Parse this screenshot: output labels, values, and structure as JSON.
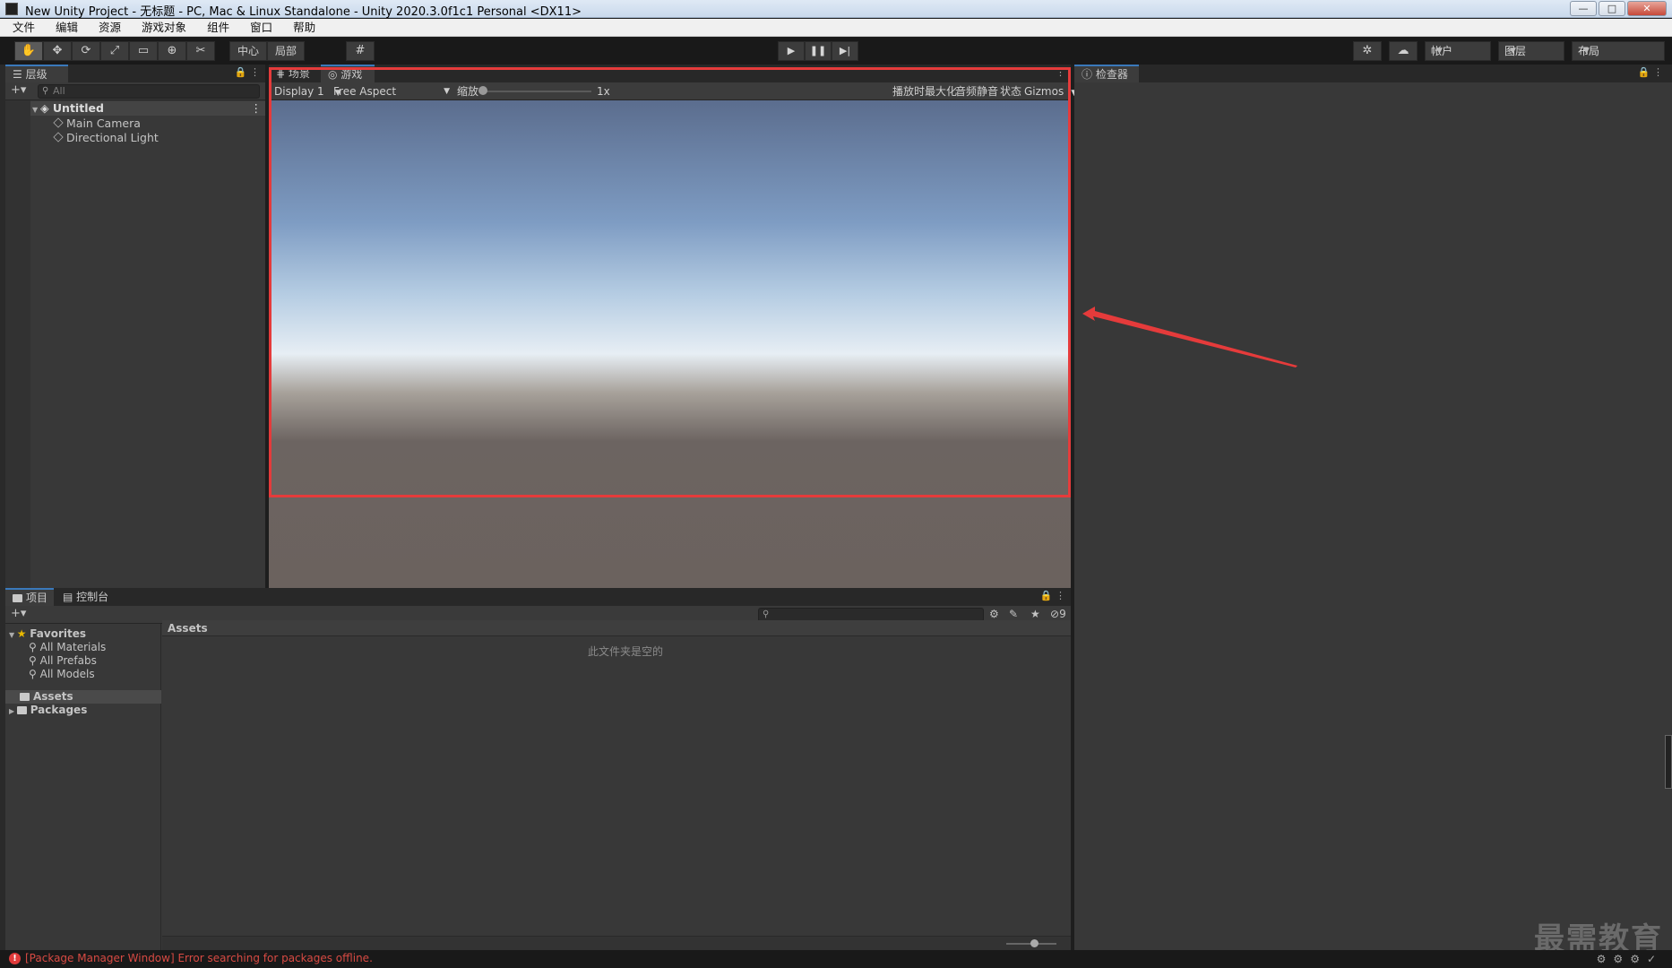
{
  "window": {
    "title": "New Unity Project - 无标题 - PC, Mac & Linux Standalone - Unity 2020.3.0f1c1 Personal <DX11>",
    "min": "—",
    "max": "□",
    "close": "✕"
  },
  "menu": [
    "文件",
    "编辑",
    "资源",
    "游戏对象",
    "组件",
    "窗口",
    "帮助"
  ],
  "toolbar": {
    "tools": [
      "✋",
      "✥",
      "⟳",
      "⤢",
      "▭",
      "⊕",
      "✂"
    ],
    "pivot": "中心",
    "local": "局部",
    "grid": "#",
    "play": "▶",
    "pause": "❚❚",
    "step": "▶|",
    "account": "帐户",
    "layers": "图层",
    "layout": "布局"
  },
  "hierarchy": {
    "tab": "层级",
    "search_placeholder": "All",
    "scene": "Untitled",
    "objects": [
      "Main Camera",
      "Directional Light"
    ]
  },
  "game": {
    "tab_scene": "场景",
    "tab_game": "游戏",
    "display": "Display 1",
    "aspect": "Free Aspect",
    "scale_label": "缩放",
    "scale_value": "1x",
    "maximize": "播放时最大化",
    "mute": "音频静音",
    "stats": "状态",
    "gizmos": "Gizmos"
  },
  "inspector": {
    "tab": "检查器"
  },
  "project": {
    "tab_project": "项目",
    "tab_console": "控制台",
    "favorites": "Favorites",
    "fav_items": [
      "All Materials",
      "All Prefabs",
      "All Models"
    ],
    "assets": "Assets",
    "packages": "Packages",
    "breadcrumb": "Assets",
    "empty_message": "此文件夹是空的",
    "hidden_count": "9"
  },
  "status": {
    "error": "[Package Manager Window] Error searching for packages offline."
  },
  "watermark": "最需教育",
  "colors": {
    "accent_red": "#e53b3b",
    "error_text": "#d84a43",
    "panel_bg": "#383838"
  }
}
